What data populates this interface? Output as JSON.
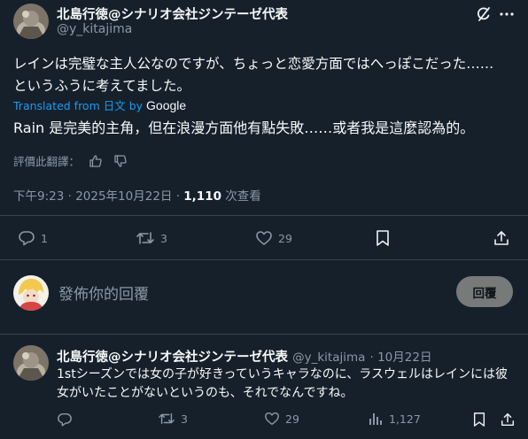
{
  "post": {
    "display_name": "北島行徳@シナリオ会社ジンテーゼ代表",
    "handle": "@y_kitajima",
    "text": "レインは完璧な主人公なのですが、ちょっと恋愛方面ではへっぽこだった……というふうに考えてました。",
    "translated_from": "Translated from 日文 by",
    "translator": "Google",
    "translation": "Rain 是完美的主角，但在浪漫方面他有點失敗……或者我是這麼認為的。",
    "rate_label": "評價此翻譯：",
    "time": "下午9:23 · 2025年10月22日 · ",
    "views_count": "1,110",
    "views_label": " 次查看",
    "replies": "1",
    "reposts": "3",
    "likes": "29"
  },
  "composer": {
    "placeholder": "發佈你的回覆",
    "reply_button": "回覆"
  },
  "reply": {
    "display_name": "北島行徳@シナリオ会社ジンテーゼ代表",
    "handle": "@y_kitajima",
    "date": "· 10月22日",
    "text": "1stシーズンでは女の子が好きっていうキャラなのに、ラスウェルはレインには彼女がいたことがないというのも、それでなんですね。",
    "reposts": "3",
    "likes": "29",
    "views": "1,127"
  },
  "colors": {
    "background": "#15202b",
    "accent": "#1d9bf0",
    "muted": "#8b98a5",
    "divider": "#38444d"
  }
}
